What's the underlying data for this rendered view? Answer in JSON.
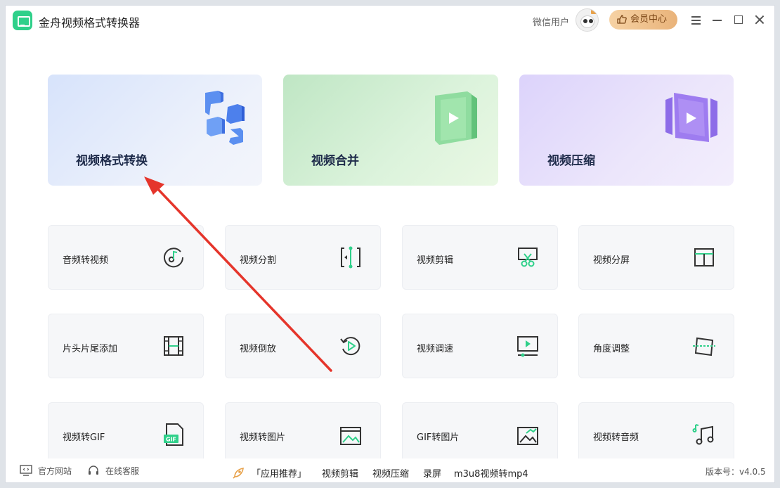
{
  "app": {
    "title": "金舟视频格式转换器",
    "user_name": "微信用户",
    "vip_label": "会员中心",
    "logo_icon": "app-logo-icon",
    "accent_color": "#2fd08a"
  },
  "feature_cards": [
    {
      "label": "视频格式转换",
      "icon": "convert-cubes-icon"
    },
    {
      "label": "视频合并",
      "icon": "merge-play-icon"
    },
    {
      "label": "视频压缩",
      "icon": "compress-play-icon"
    }
  ],
  "tools": [
    {
      "label": "音频转视频",
      "icon": "audio-to-video-icon"
    },
    {
      "label": "视频分割",
      "icon": "split-icon"
    },
    {
      "label": "视频剪辑",
      "icon": "scissors-icon"
    },
    {
      "label": "视频分屏",
      "icon": "split-screen-icon"
    },
    {
      "label": "片头片尾添加",
      "icon": "film-icon"
    },
    {
      "label": "视频倒放",
      "icon": "reverse-play-icon"
    },
    {
      "label": "视频调速",
      "icon": "speed-icon"
    },
    {
      "label": "角度调整",
      "icon": "rotate-frame-icon"
    },
    {
      "label": "视频转GIF",
      "icon": "gif-file-icon"
    },
    {
      "label": "视频转图片",
      "icon": "image-icon"
    },
    {
      "label": "GIF转图片",
      "icon": "gif-image-icon"
    },
    {
      "label": "视频转音频",
      "icon": "music-note-icon"
    }
  ],
  "footer": {
    "website": "官方网站",
    "support": "在线客服",
    "recommend": "「应用推荐」",
    "links": [
      "视频剪辑",
      "视频压缩",
      "录屏",
      "m3u8视频转mp4"
    ],
    "version": "版本号：v4.0.5"
  },
  "annotation": {
    "arrow_color": "#e5352b"
  }
}
